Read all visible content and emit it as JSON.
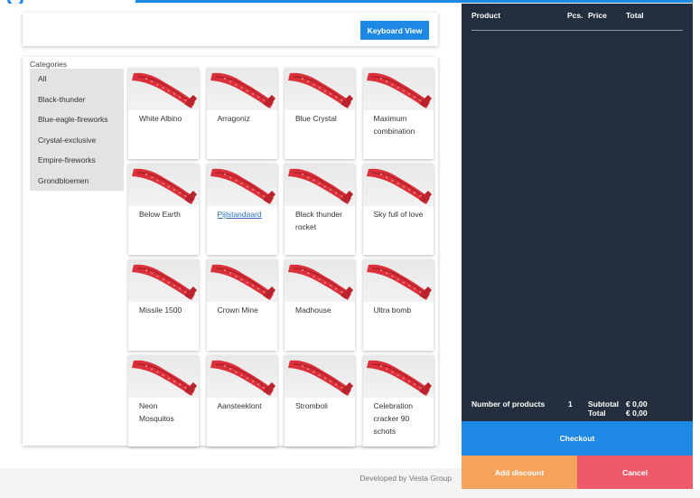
{
  "header": {
    "logo_icon": "brand-ring-icon"
  },
  "toolbar": {
    "keyboard_view_label": "Keyboard View"
  },
  "categories": {
    "title": "Categories",
    "items": [
      {
        "label": "All"
      },
      {
        "label": "Black-thunder"
      },
      {
        "label": "Blue-eagle-fireworks"
      },
      {
        "label": "Crystal-exclusive"
      },
      {
        "label": "Empire-fireworks"
      },
      {
        "label": "Grondbloemen"
      }
    ]
  },
  "products": [
    {
      "name": "White Albino",
      "image_icon": "red-firework-product-icon"
    },
    {
      "name": "Arragoniz",
      "image_icon": "red-firework-product-icon"
    },
    {
      "name": "Blue Crystal",
      "image_icon": "red-firework-product-icon"
    },
    {
      "name": "Maximum combination",
      "image_icon": "red-firework-product-icon"
    },
    {
      "name": "Below Earth",
      "image_icon": "red-firework-product-icon"
    },
    {
      "name": "Pijlstandaard",
      "image_icon": "red-firework-product-icon",
      "hovered": true
    },
    {
      "name": "Black thunder rocket",
      "image_icon": "red-firework-product-icon"
    },
    {
      "name": "Sky full of love",
      "image_icon": "red-firework-product-icon"
    },
    {
      "name": "Missile 1500",
      "image_icon": "red-firework-product-icon"
    },
    {
      "name": "Crown Mine",
      "image_icon": "red-firework-product-icon"
    },
    {
      "name": "Madhouse",
      "image_icon": "red-firework-product-icon"
    },
    {
      "name": "Ultra bomb",
      "image_icon": "red-firework-product-icon"
    },
    {
      "name": "Neon Mosquitos",
      "image_icon": "red-firework-product-icon"
    },
    {
      "name": "Aansteeklont",
      "image_icon": "red-firework-product-icon"
    },
    {
      "name": "Stromboli",
      "image_icon": "red-firework-product-icon"
    },
    {
      "name": "Celebration cracker 90 schots",
      "image_icon": "red-firework-product-icon"
    }
  ],
  "footer": {
    "text": "Developed by Vesta Group"
  },
  "cart": {
    "columns": {
      "product": "Product",
      "pcs": "Pcs.",
      "price": "Price",
      "total": "Total"
    },
    "summary": {
      "count_label": "Number of products",
      "count_value": "1",
      "subtotal_label": "Subtotal",
      "subtotal_value": "€ 0,00",
      "total_label": "Total",
      "total_value": "€ 0,00"
    },
    "checkout_label": "Checkout",
    "discount_label": "Add discount",
    "cancel_label": "Cancel"
  },
  "colors": {
    "accent": "#1e88e5",
    "cart_bg": "#232f3e",
    "discount": "#f5a25d",
    "cancel": "#ee5a6a",
    "product_red": "#d9303a"
  }
}
